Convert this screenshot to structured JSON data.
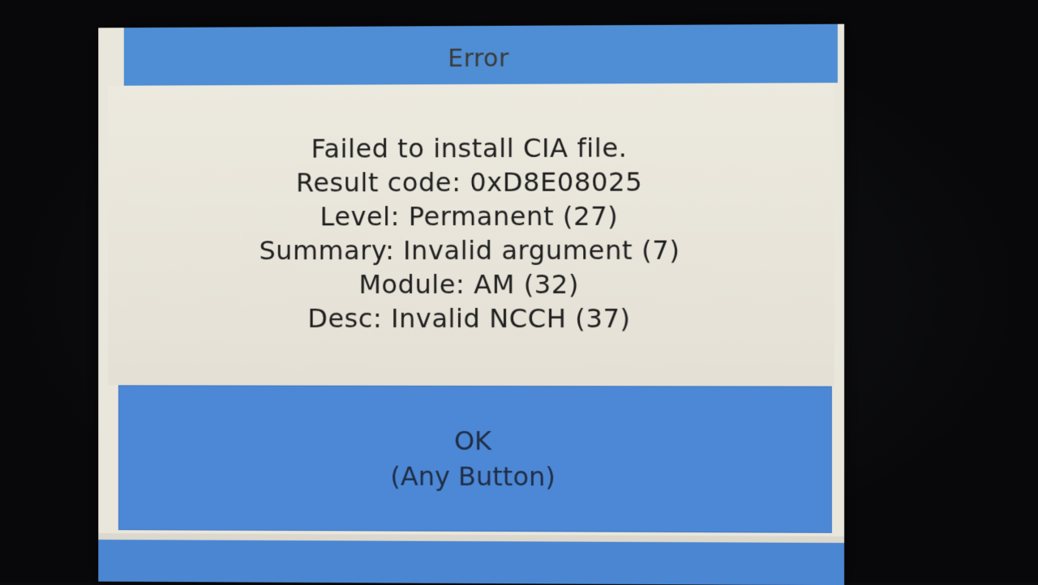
{
  "dialog": {
    "title": "Error",
    "message_lines": [
      "Failed to install CIA file.",
      "Result code: 0xD8E08025",
      "Level: Permanent (27)",
      "Summary: Invalid argument (7)",
      "Module: AM (32)",
      "Desc: Invalid NCCH (37)"
    ],
    "ok_button": {
      "label": "OK",
      "sublabel": "(Any Button)"
    }
  },
  "colors": {
    "title_bar": "#4f8ed4",
    "background": "#e9e6dc",
    "button": "#4d88d6",
    "text": "#1f1f1f"
  }
}
